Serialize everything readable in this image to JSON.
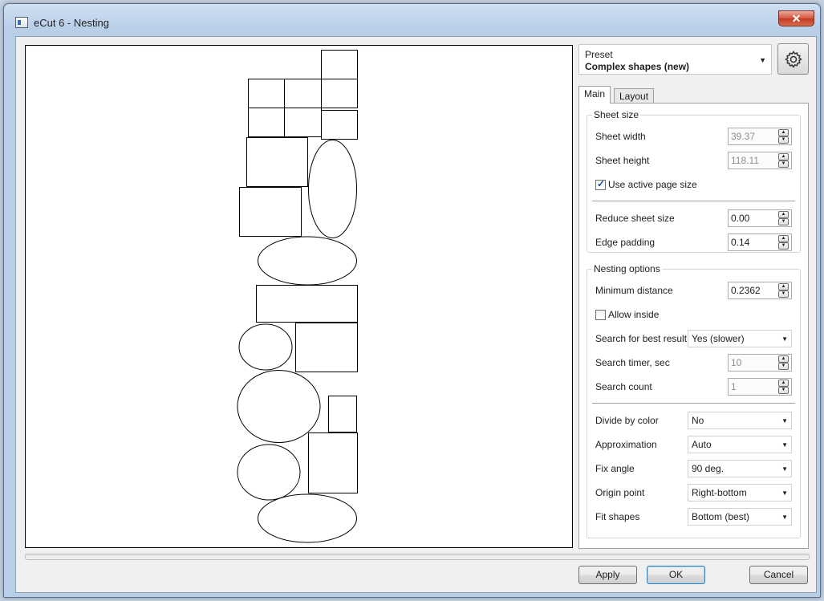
{
  "window": {
    "title": "eCut 6 - Nesting",
    "close_label": "✕"
  },
  "preset": {
    "caption": "Preset",
    "value": "Complex shapes (new)"
  },
  "tabs": [
    {
      "label": "Main"
    },
    {
      "label": "Layout"
    }
  ],
  "sheet_size": {
    "title": "Sheet size",
    "sheet_width": {
      "label": "Sheet width",
      "value": "39.37"
    },
    "sheet_height": {
      "label": "Sheet height",
      "value": "118.11"
    },
    "use_active_page": {
      "label": "Use active page size",
      "checked": true
    },
    "reduce_sheet_size": {
      "label": "Reduce sheet size",
      "value": "0.00"
    },
    "edge_padding": {
      "label": "Edge padding",
      "value": "0.14"
    }
  },
  "nesting_options": {
    "title": "Nesting options",
    "minimum_distance": {
      "label": "Minimum distance",
      "value": "0.2362"
    },
    "allow_inside": {
      "label": "Allow inside",
      "checked": false
    },
    "search_best": {
      "label": "Search for best result",
      "value": "Yes (slower)"
    },
    "search_timer": {
      "label": "Search timer, sec",
      "value": "10"
    },
    "search_count": {
      "label": "Search count",
      "value": "1"
    },
    "divide_by_color": {
      "label": "Divide by color",
      "value": "No"
    },
    "approximation": {
      "label": "Approximation",
      "value": "Auto"
    },
    "fix_angle": {
      "label": "Fix angle",
      "value": "90 deg."
    },
    "origin_point": {
      "label": "Origin point",
      "value": "Right-bottom"
    },
    "fit_shapes": {
      "label": "Fit shapes",
      "value": "Bottom (best)"
    }
  },
  "buttons": {
    "apply": "Apply",
    "ok": "OK",
    "cancel": "Cancel"
  },
  "icons": {
    "settings": "gear-icon",
    "app": "app-icon",
    "close": "close-icon"
  }
}
